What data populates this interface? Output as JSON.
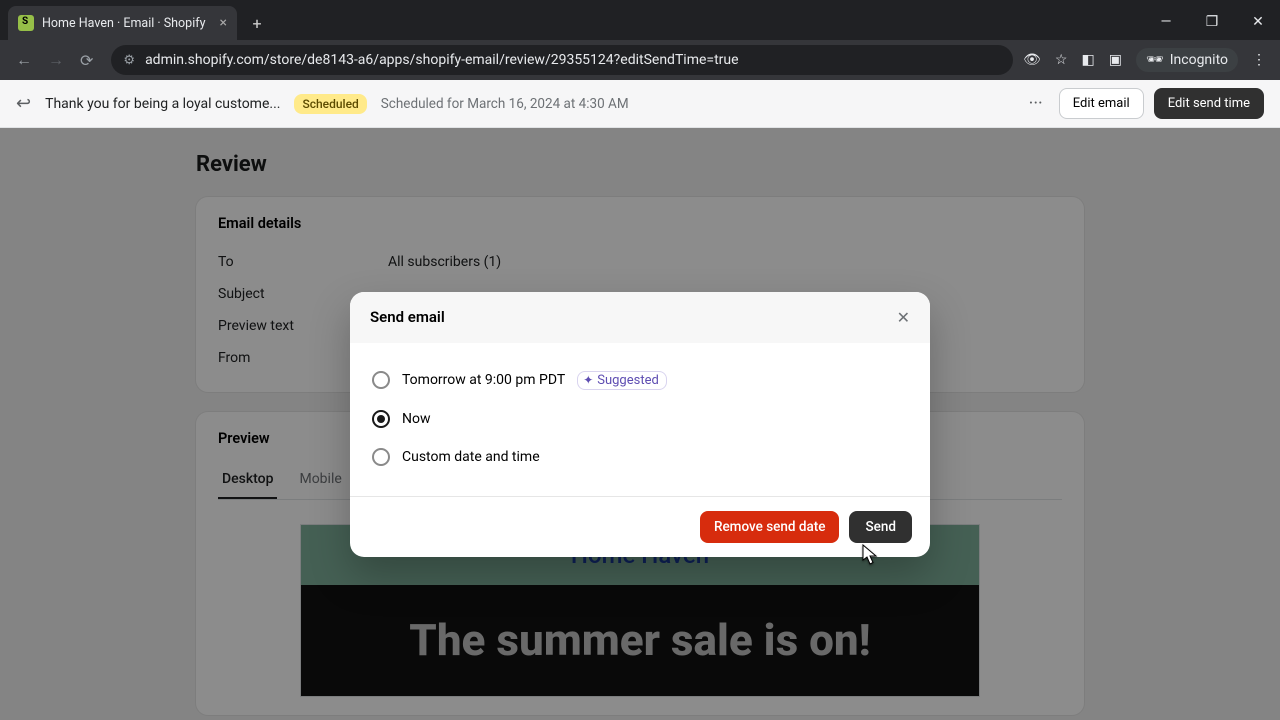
{
  "browser": {
    "tab_title": "Home Haven · Email · Shopify",
    "url": "admin.shopify.com/store/de8143-a6/apps/shopify-email/review/29355124?editSendTime=true",
    "incognito_label": "Incognito"
  },
  "appbar": {
    "back_icon": "←",
    "title": "Thank you for being a loyal custome...",
    "badge": "Scheduled",
    "schedule_text": "Scheduled for March 16, 2024 at 4:30 AM",
    "more_icon": "···",
    "edit_email": "Edit email",
    "edit_send_time": "Edit send time"
  },
  "page": {
    "heading": "Review",
    "details_heading": "Email details",
    "rows": {
      "to": {
        "label": "To",
        "value": "All subscribers (1)"
      },
      "subject": {
        "label": "Subject",
        "value": ""
      },
      "preview_text": {
        "label": "Preview text",
        "value": ""
      },
      "from": {
        "label": "From",
        "value": ""
      }
    },
    "preview_heading": "Preview",
    "tabs": {
      "desktop": "Desktop",
      "mobile": "Mobile"
    },
    "email_preview": {
      "brand": "Home Haven",
      "hero_text": "The summer sale is on!"
    }
  },
  "modal": {
    "title": "Send email",
    "options": {
      "tomorrow": "Tomorrow at 9:00 pm PDT",
      "suggested_badge": "Suggested",
      "now": "Now",
      "custom": "Custom date and time"
    },
    "selected": "now",
    "remove_btn": "Remove send date",
    "send_btn": "Send"
  }
}
